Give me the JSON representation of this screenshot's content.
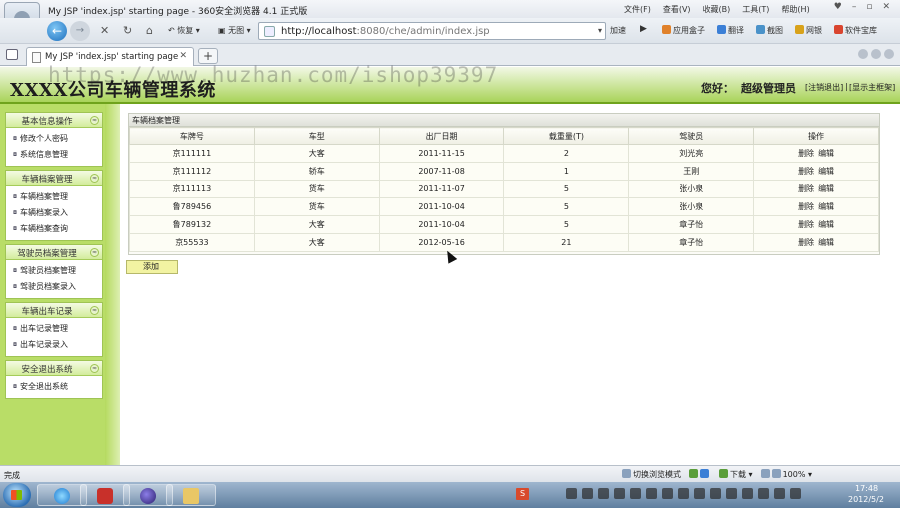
{
  "browser": {
    "window_title": "My JSP 'index.jsp' starting page - 360安全浏览器 4.1 正式版",
    "menu": [
      "文件(F)",
      "查看(V)",
      "收藏(B)",
      "工具(T)",
      "帮助(H)"
    ],
    "nav": {
      "restore_label": "恢复",
      "noimage_label": "无图",
      "url_host": "http://localhost",
      "url_path": ":8080/che/admin/index.jsp",
      "speed_label": "加速"
    },
    "toolbar_right": [
      {
        "label": "应用盒子",
        "color": "#e0812a"
      },
      {
        "label": "翻译",
        "color": "#3b7fd6"
      },
      {
        "label": "截图",
        "color": "#4a92c9"
      },
      {
        "label": "网银",
        "color": "#d8a21a"
      },
      {
        "label": "软件宝库",
        "color": "#d9452f"
      }
    ],
    "tab_label": "My JSP 'index.jsp' starting page",
    "newtab_label": "+",
    "status_text": "完成",
    "status_right": [
      "切换浏览模式",
      "下载",
      "100%"
    ]
  },
  "header": {
    "system_title": "XXXX公司车辆管理系统",
    "greeting": "您好：",
    "username": "超级管理员",
    "logout_link": "[注销退出]",
    "home_link": "[显示主框架]",
    "watermark": "https://www.huzhan.com/ishop39397"
  },
  "sidebar": {
    "groups": [
      {
        "title": "基本信息操作",
        "items": [
          "修改个人密码",
          "系统信息管理"
        ]
      },
      {
        "title": "车辆档案管理",
        "items": [
          "车辆档案管理",
          "车辆档案录入",
          "车辆档案查询"
        ]
      },
      {
        "title": "驾驶员档案管理",
        "items": [
          "驾驶员档案管理",
          "驾驶员档案录入"
        ]
      },
      {
        "title": "车辆出车记录",
        "items": [
          "出车记录管理",
          "出车记录录入"
        ]
      },
      {
        "title": "安全退出系统",
        "items": [
          "安全退出系统"
        ]
      }
    ]
  },
  "content": {
    "panel_title": "车辆档案管理",
    "columns": [
      "车牌号",
      "车型",
      "出厂日期",
      "载重量(T)",
      "驾驶员",
      "操作"
    ],
    "rows": [
      {
        "plate": "京111111",
        "type": "大客",
        "date": "2011-11-15",
        "load": "2",
        "driver": "刘光亮",
        "del": "删除",
        "edit": "编辑"
      },
      {
        "plate": "京111112",
        "type": "轿车",
        "date": "2007-11-08",
        "load": "1",
        "driver": "王刚",
        "del": "删除",
        "edit": "编辑"
      },
      {
        "plate": "京111113",
        "type": "货车",
        "date": "2011-11-07",
        "load": "5",
        "driver": "张小泉",
        "del": "删除",
        "edit": "编辑"
      },
      {
        "plate": "鲁789456",
        "type": "货车",
        "date": "2011-10-04",
        "load": "5",
        "driver": "张小泉",
        "del": "删除",
        "edit": "编辑"
      },
      {
        "plate": "鲁789132",
        "type": "大客",
        "date": "2011-10-04",
        "load": "5",
        "driver": "章子怡",
        "del": "删除",
        "edit": "编辑"
      },
      {
        "plate": "京55533",
        "type": "大客",
        "date": "2012-05-16",
        "load": "21",
        "driver": "章子怡",
        "del": "删除",
        "edit": "编辑"
      }
    ],
    "add_button": "添加"
  },
  "taskbar": {
    "time": "17:48",
    "date": "2012/5/2",
    "s_icon": "S"
  }
}
